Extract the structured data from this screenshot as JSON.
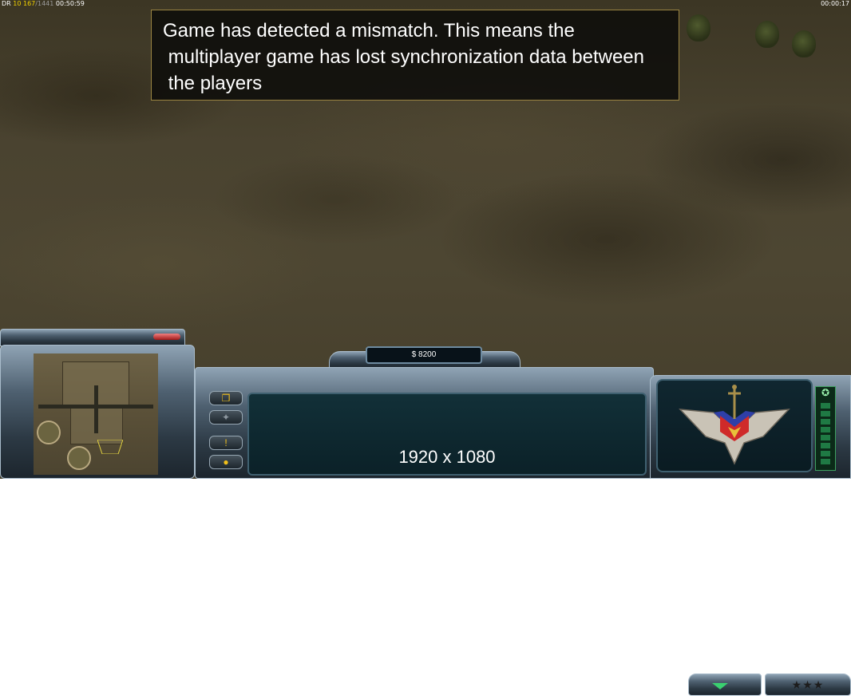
{
  "hud": {
    "fps_prefix": "DR",
    "fps_value": "10",
    "frame_count": "167",
    "frame_total": "1441",
    "game_time": "00:50:59",
    "right_time": "00:00:17"
  },
  "message": {
    "line1": "Game has detected a mismatch. This means the",
    "line2": " multiplayer game has lost synchronization data between",
    "line3": " the players"
  },
  "control_bar": {
    "money": "$ 8200",
    "resolution_text": "1920 x 1080",
    "rank_stars": "★★★",
    "power_icon": "✪",
    "power_level": 0.0
  },
  "colors": {
    "message_border": "#9a8442",
    "button_accent": "#f2c01a",
    "power_green": "#1f7a44"
  },
  "icons": {
    "command_buttons": [
      "windows-icon",
      "generals-powers-icon",
      "alert-icon",
      "chat-icon"
    ],
    "tab_down": "triangle-down-icon",
    "emblem": "general-rank-emblem"
  }
}
